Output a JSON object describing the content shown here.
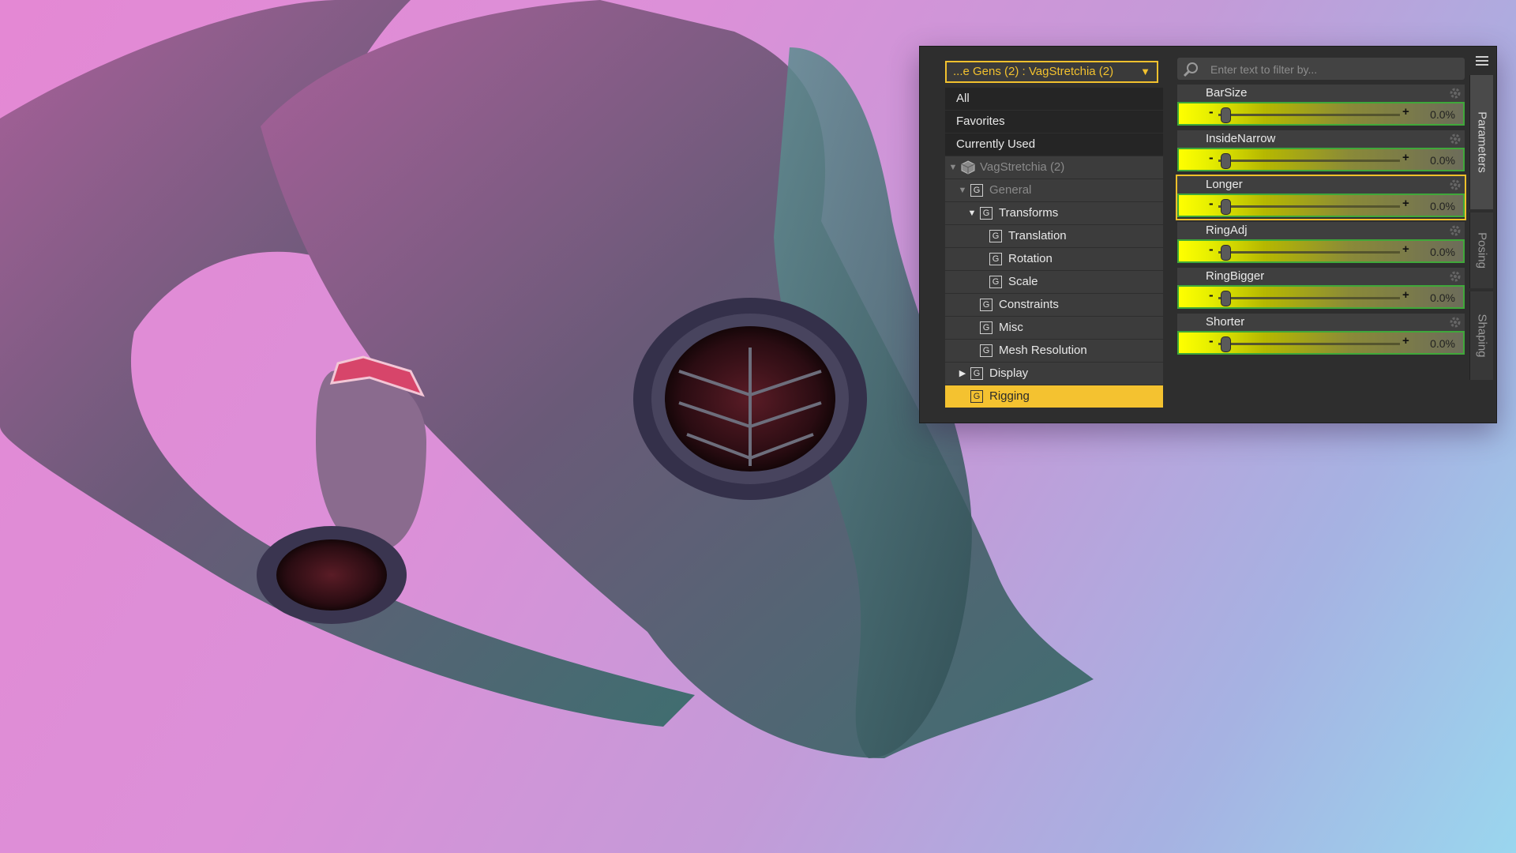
{
  "content_selector": {
    "dropdown_label": "...e Gens (2) : VagStretchia (2)",
    "tree": [
      {
        "label": "All",
        "depth": 0,
        "type": "top"
      },
      {
        "label": "Favorites",
        "depth": 0,
        "type": "top"
      },
      {
        "label": "Currently Used",
        "depth": 0,
        "type": "top"
      },
      {
        "label": "VagStretchia (2)",
        "depth": 0,
        "type": "node",
        "icon": "cube-icon",
        "expanded": true,
        "dim": true
      },
      {
        "label": "General",
        "depth": 1,
        "type": "node",
        "icon": "group-icon",
        "expanded": true,
        "dim": true
      },
      {
        "label": "Transforms",
        "depth": 2,
        "type": "node",
        "icon": "group-icon",
        "expanded": true
      },
      {
        "label": "Translation",
        "depth": 3,
        "type": "node",
        "icon": "group-icon"
      },
      {
        "label": "Rotation",
        "depth": 3,
        "type": "node",
        "icon": "group-icon"
      },
      {
        "label": "Scale",
        "depth": 3,
        "type": "node",
        "icon": "group-icon"
      },
      {
        "label": "Constraints",
        "depth": 2,
        "type": "node",
        "icon": "group-icon"
      },
      {
        "label": "Misc",
        "depth": 2,
        "type": "node",
        "icon": "group-icon"
      },
      {
        "label": "Mesh Resolution",
        "depth": 2,
        "type": "node",
        "icon": "group-icon"
      },
      {
        "label": "Display",
        "depth": 1,
        "type": "node",
        "icon": "group-icon",
        "expanded": false
      },
      {
        "label": "Rigging",
        "depth": 1,
        "type": "node",
        "icon": "group-icon",
        "selected": true
      }
    ]
  },
  "parameters": {
    "search_placeholder": "Enter text to filter by...",
    "items": [
      {
        "name": "BarSize",
        "value_text": "0.0%",
        "fraction": 0.04
      },
      {
        "name": "InsideNarrow",
        "value_text": "0.0%",
        "fraction": 0.04
      },
      {
        "name": "Longer",
        "value_text": "0.0%",
        "fraction": 0.04,
        "highlight": true
      },
      {
        "name": "RingAdj",
        "value_text": "0.0%",
        "fraction": 0.04
      },
      {
        "name": "RingBigger",
        "value_text": "0.0%",
        "fraction": 0.04
      },
      {
        "name": "Shorter",
        "value_text": "0.0%",
        "fraction": 0.04
      }
    ]
  },
  "side_tabs": [
    {
      "label": "Parameters",
      "active": true
    },
    {
      "label": "Posing",
      "active": false
    },
    {
      "label": "Shaping",
      "active": false
    }
  ],
  "colors": {
    "accent": "#f4c230",
    "slider_fill": "#ffff00",
    "slider_border": "#3fa83a"
  }
}
